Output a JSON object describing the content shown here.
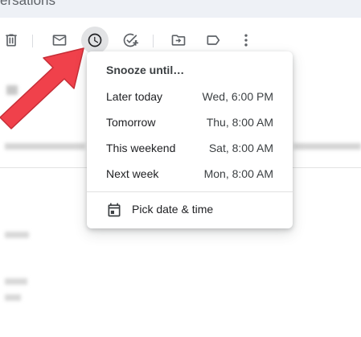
{
  "search": {
    "text": "ersations"
  },
  "toolbar": {
    "icons": [
      "delete-icon",
      "mark-unread-icon",
      "snooze-icon",
      "add-task-icon",
      "move-to-icon",
      "label-icon",
      "more-vert-icon"
    ]
  },
  "snooze_menu": {
    "title": "Snooze until…",
    "options": [
      {
        "label": "Later today",
        "time": "Wed, 6:00 PM"
      },
      {
        "label": "Tomorrow",
        "time": "Thu, 8:00 AM"
      },
      {
        "label": "This weekend",
        "time": "Sat, 8:00 AM"
      },
      {
        "label": "Next week",
        "time": "Mon, 8:00 AM"
      }
    ],
    "pick_label": "Pick date & time"
  },
  "colors": {
    "arrow": "#f0414b",
    "icon": "#5f6368",
    "search_bg": "#eef1f6",
    "active_icon_bg": "#e2e3e5"
  }
}
